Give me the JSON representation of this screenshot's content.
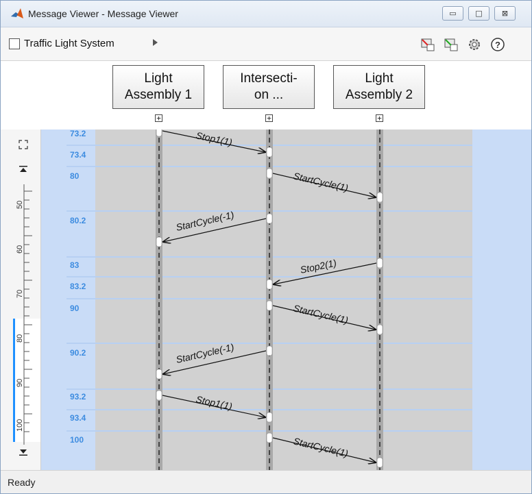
{
  "window": {
    "title": "Message Viewer - Message Viewer",
    "minimize_glyph": "▭",
    "maximize_glyph": "□",
    "close_glyph": "⊠"
  },
  "toolbar": {
    "breadcrumb": "Traffic Light System"
  },
  "lifelines": [
    {
      "label_line1": "Light",
      "label_line2": "Assembly 1"
    },
    {
      "label_line1": "Intersecti-",
      "label_line2": "on ..."
    },
    {
      "label_line1": "Light",
      "label_line2": "Assembly 2"
    }
  ],
  "time_labels": [
    "73.2",
    "73.4",
    "80",
    "80.2",
    "83",
    "83.2",
    "90",
    "90.2",
    "93.2",
    "93.4",
    "100"
  ],
  "messages": [
    {
      "label": "Stop1(1)"
    },
    {
      "label": "StartCycle(1)"
    },
    {
      "label": "StartCycle(-1)"
    },
    {
      "label": "Stop2(1)"
    },
    {
      "label": "StartCycle(1)"
    },
    {
      "label": "StartCycle(-1)"
    },
    {
      "label": "Stop1(1)"
    },
    {
      "label": "StartCycle(1)"
    }
  ],
  "ruler_labels": [
    "50",
    "60",
    "70",
    "80",
    "90",
    "100"
  ],
  "status": {
    "text": "Ready"
  },
  "colors": {
    "accent": "#3d8ce0",
    "diagram_background": "#c9dcf7",
    "lifeline_lane": "#d1d1d1"
  }
}
